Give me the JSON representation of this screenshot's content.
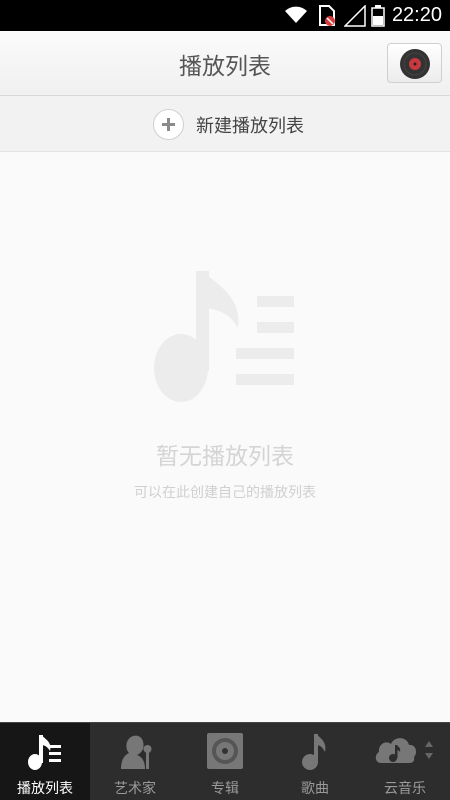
{
  "status_bar": {
    "time": "22:20",
    "icons": [
      "wifi-icon",
      "sim-blocked-icon",
      "signal-icon",
      "battery-icon"
    ]
  },
  "header": {
    "title": "播放列表",
    "now_playing_icon": "vinyl-record-icon"
  },
  "new_playlist": {
    "label": "新建播放列表",
    "icon": "plus-icon"
  },
  "empty_state": {
    "icon": "music-playlist-icon",
    "title": "暂无播放列表",
    "subtitle": "可以在此创建自己的播放列表"
  },
  "tabs": [
    {
      "label": "播放列表",
      "icon": "playlist-icon",
      "active": true
    },
    {
      "label": "艺术家",
      "icon": "artist-icon",
      "active": false
    },
    {
      "label": "专辑",
      "icon": "album-icon",
      "active": false
    },
    {
      "label": "歌曲",
      "icon": "music-note-icon",
      "active": false
    },
    {
      "label": "云音乐",
      "icon": "cloud-music-icon",
      "active": false
    }
  ],
  "colors": {
    "accent_record": "#c8383c",
    "tab_bar": "#2d2d2d",
    "tab_active": "#161616"
  }
}
